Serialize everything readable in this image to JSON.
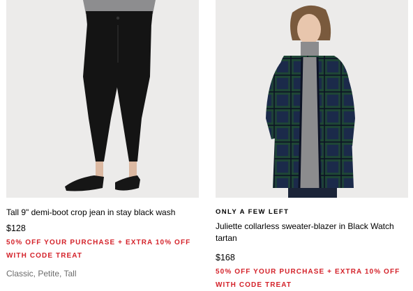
{
  "products": [
    {
      "image_alt": "Tall 9\" demi-boot crop jean in stay black wash",
      "badge": "",
      "title": "Tall 9\" demi-boot crop jean in stay black wash",
      "price": "$128",
      "promo": "50% OFF YOUR PURCHASE + EXTRA 10% OFF WITH CODE TREAT",
      "sizes": "Classic, Petite, Tall"
    },
    {
      "image_alt": "Juliette collarless sweater-blazer in Black Watch tartan",
      "badge": "ONLY A FEW LEFT",
      "title": "Juliette collarless sweater-blazer in Black Watch tartan",
      "price": "$168",
      "promo": "50% OFF YOUR PURCHASE + EXTRA 10% OFF WITH CODE TREAT",
      "sizes": ""
    }
  ],
  "colors": {
    "promo": "#d4222a",
    "meta": "#6b6b6b",
    "photo_bg": "#ecebea"
  }
}
